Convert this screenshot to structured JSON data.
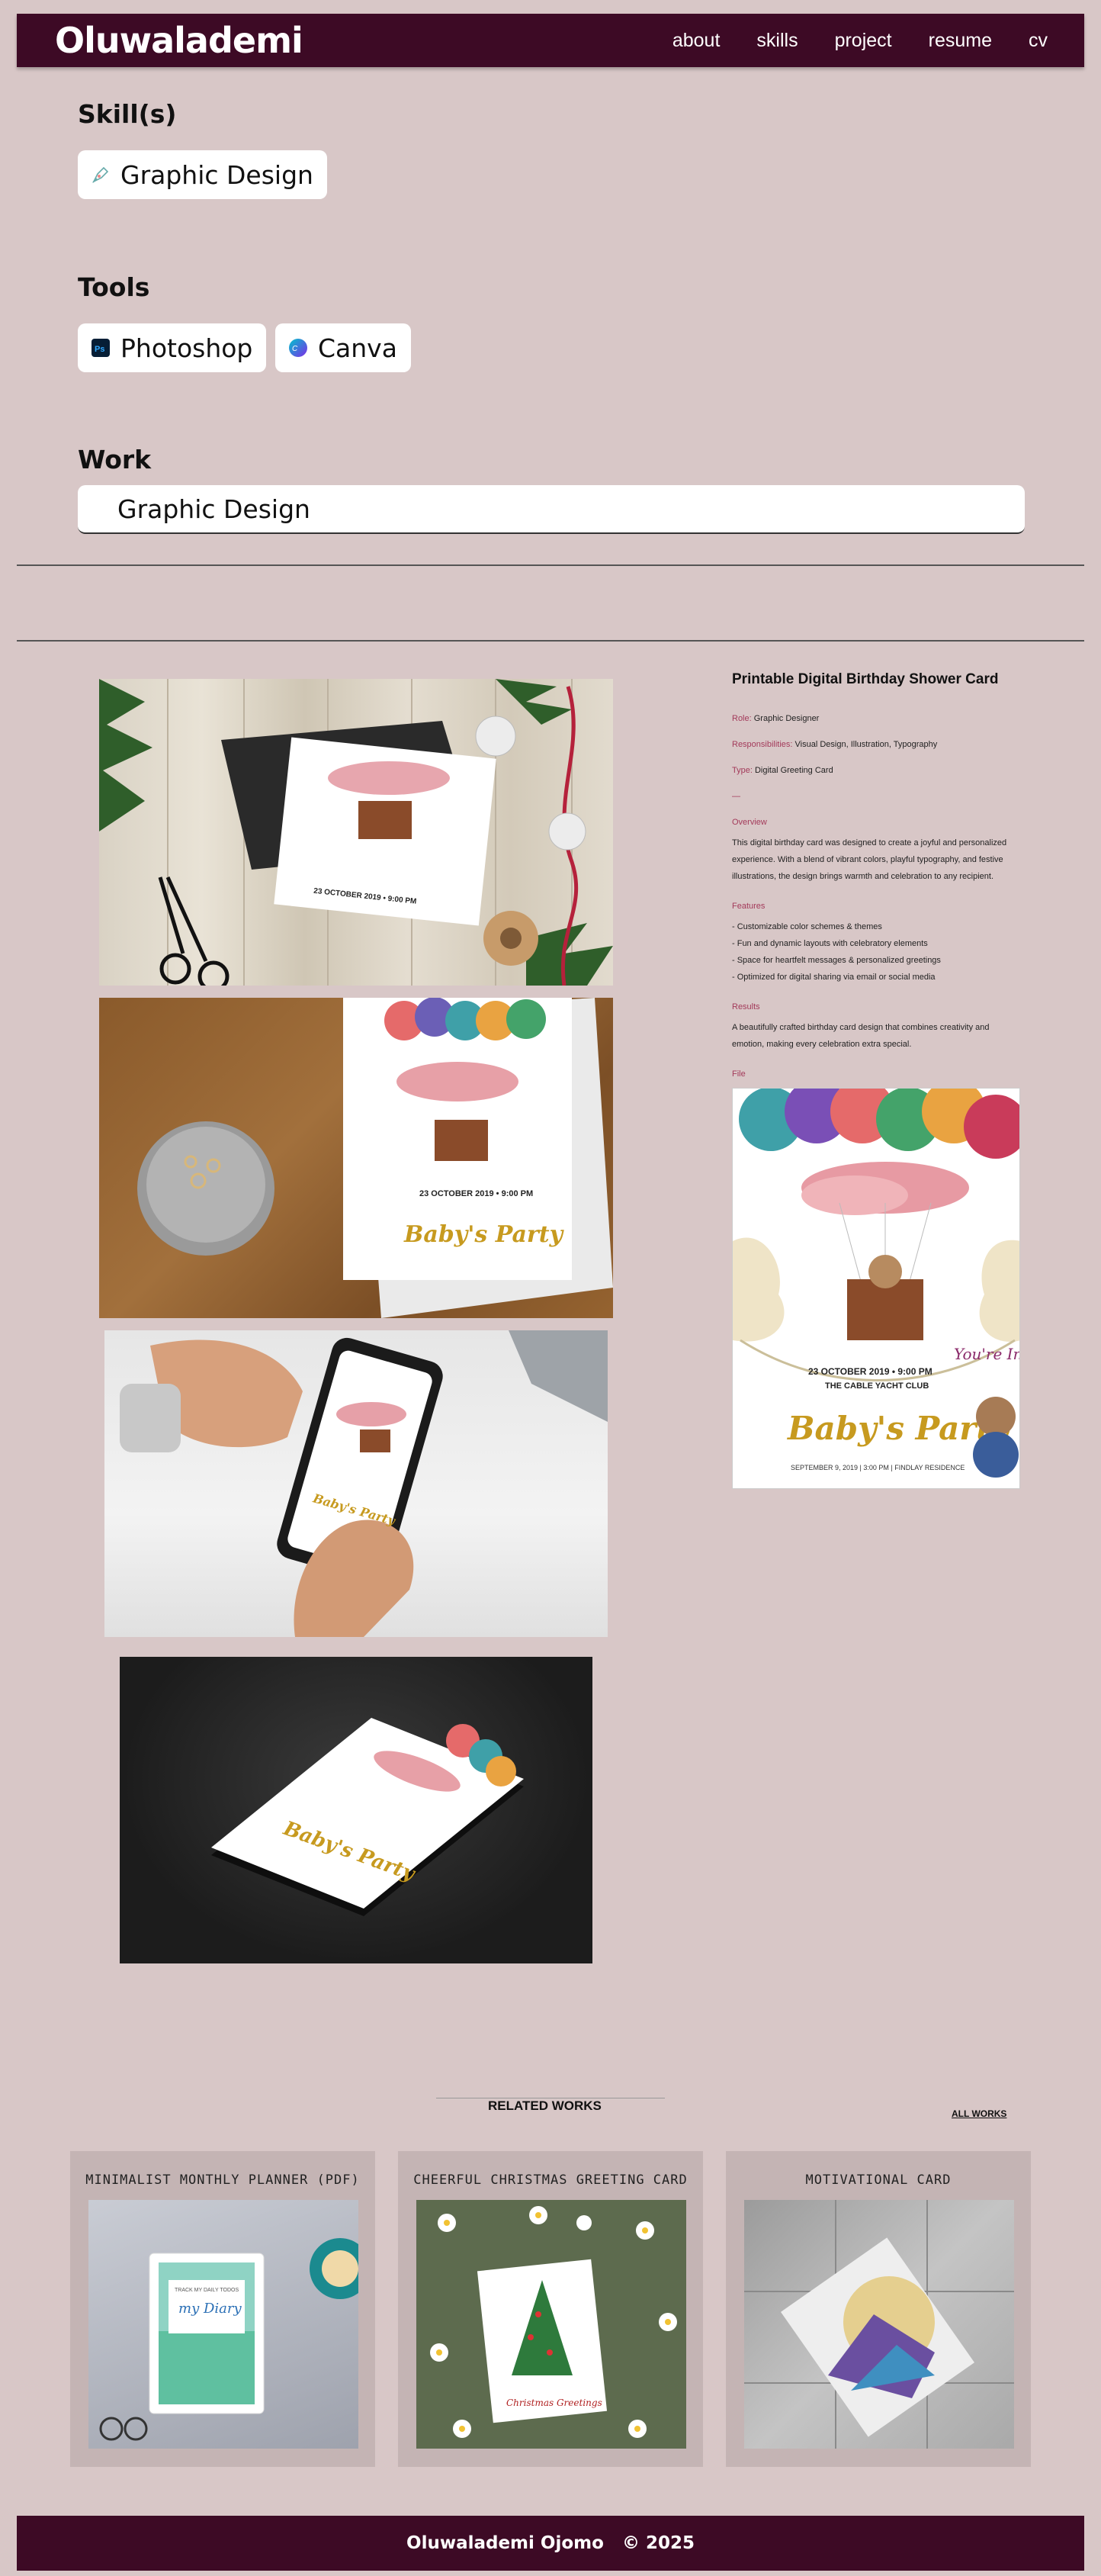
{
  "header": {
    "logo": "Oluwalademi",
    "nav": [
      "about",
      "skills",
      "project",
      "resume",
      "cv"
    ]
  },
  "skills_section": {
    "title": "Skill(s)",
    "items": [
      {
        "label": "Graphic Design",
        "icon": "pen-tool-icon"
      }
    ]
  },
  "tools_section": {
    "title": "Tools",
    "items": [
      {
        "label": "Photoshop",
        "icon": "photoshop-icon"
      },
      {
        "label": "Canva",
        "icon": "canva-icon"
      }
    ]
  },
  "work_section": {
    "title": "Work",
    "bar_label": "Graphic Design"
  },
  "project": {
    "title": "Printable Digital Birthday Shower Card",
    "role_label": "Role:",
    "role_value": "Graphic Designer",
    "responsibilities_label": "Responsibilities:",
    "responsibilities_value": "Visual Design, Illustration, Typography",
    "type_label": "Type:",
    "type_value": "Digital Greeting Card",
    "divider": "—",
    "overview_heading": "Overview",
    "overview_text": "This digital birthday card was designed to create a joyful and personalized experience. With a blend of vibrant colors, playful typography, and festive illustrations, the design brings warmth and celebration to any recipient.",
    "features_heading": "Features",
    "features": [
      "- Customizable color schemes & themes",
      "- Fun and dynamic layouts with celebratory elements",
      "- Space for heartfelt messages & personalized greetings",
      "- Optimized for digital sharing via email or social media"
    ],
    "results_heading": "Results",
    "results_text": "A beautifully crafted birthday card design that combines creativity and emotion, making every celebration extra special.",
    "file_heading": "File"
  },
  "card_art": {
    "date_line": "23 OCTOBER 2019  •  9:00 PM",
    "venue": "THE CABLE YACHT CLUB",
    "invited": "You're Invited!",
    "party": "Baby's Party",
    "footer_line": "SEPTEMBER 9, 2019 | 3:00 PM | FINDLAY RESIDENCE"
  },
  "related": {
    "title": "RELATED WORKS",
    "all_works": "ALL WORKS",
    "cards": [
      {
        "title": "MINIMALIST MONTHLY PLANNER (PDF)",
        "art_text": "my Diary",
        "art_sub": "TRACK MY DAILY TODOS"
      },
      {
        "title": "CHEERFUL CHRISTMAS GREETING CARD",
        "art_text": "Christmas Greetings"
      },
      {
        "title": "MOTIVATIONAL CARD"
      }
    ]
  },
  "footer": {
    "name": "Oluwalademi Ojomo",
    "copyright": "© 2025"
  },
  "colors": {
    "page_bg": "#d8c7c7",
    "header_bg": "#3d0a25",
    "accent": "#a33a5a",
    "card_bg": "#c4b4b4"
  }
}
